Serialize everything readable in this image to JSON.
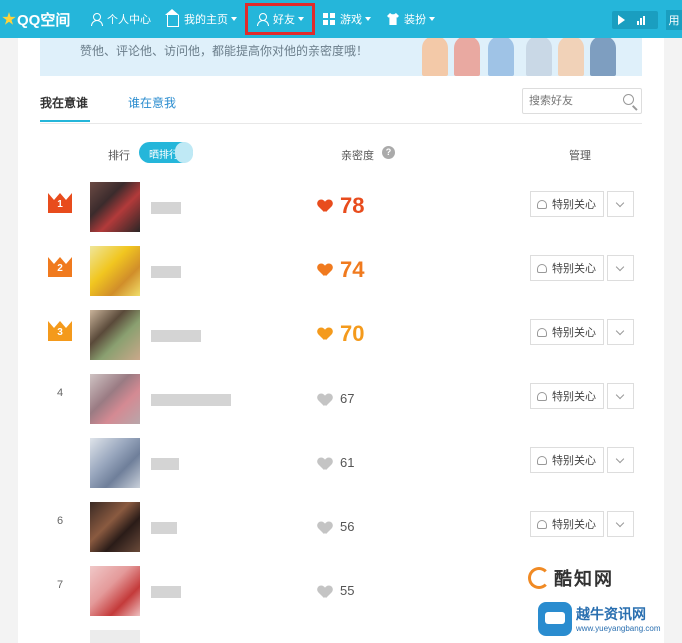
{
  "topbar": {
    "logo": "QQ空间",
    "items": [
      {
        "label": "个人中心",
        "icon": "person-icon"
      },
      {
        "label": "我的主页",
        "icon": "home-icon"
      },
      {
        "label": "好友",
        "icon": "friend-icon"
      },
      {
        "label": "游戏",
        "icon": "grid-icon"
      },
      {
        "label": "装扮",
        "icon": "shirt-icon"
      }
    ],
    "user_tab": "用"
  },
  "banner": {
    "text": "赞他、评论他、访问他，都能提高你对他的亲密度哦！"
  },
  "tabs": {
    "active": "我在意谁",
    "other": "谁在意我"
  },
  "search": {
    "placeholder": "搜索好友"
  },
  "table_head": {
    "rank": "排行",
    "toggle": "晒排行",
    "intimacy": "亲密度",
    "help": "?",
    "manage": "管理"
  },
  "rows": [
    {
      "rank": "1",
      "score": "78",
      "care_label": "特别关心"
    },
    {
      "rank": "2",
      "score": "74",
      "care_label": "特别关心"
    },
    {
      "rank": "3",
      "score": "70",
      "care_label": "特别关心"
    },
    {
      "rank": "4",
      "score": "67",
      "care_label": "特别关心"
    },
    {
      "rank": "",
      "score": "61",
      "care_label": "特别关心"
    },
    {
      "rank": "6",
      "score": "56",
      "care_label": "特别关心"
    },
    {
      "rank": "7",
      "score": "55",
      "care_label": ""
    }
  ],
  "colors": {
    "nav": "#25b6da",
    "highlight": "#e02b2b",
    "rank1": "#e84c1d",
    "rank2": "#f07a1e",
    "rank3": "#f49a1c"
  },
  "watermark": {
    "brand": "酷知网",
    "site": "越牛资讯网",
    "url": "www.yueyangbang.com"
  }
}
